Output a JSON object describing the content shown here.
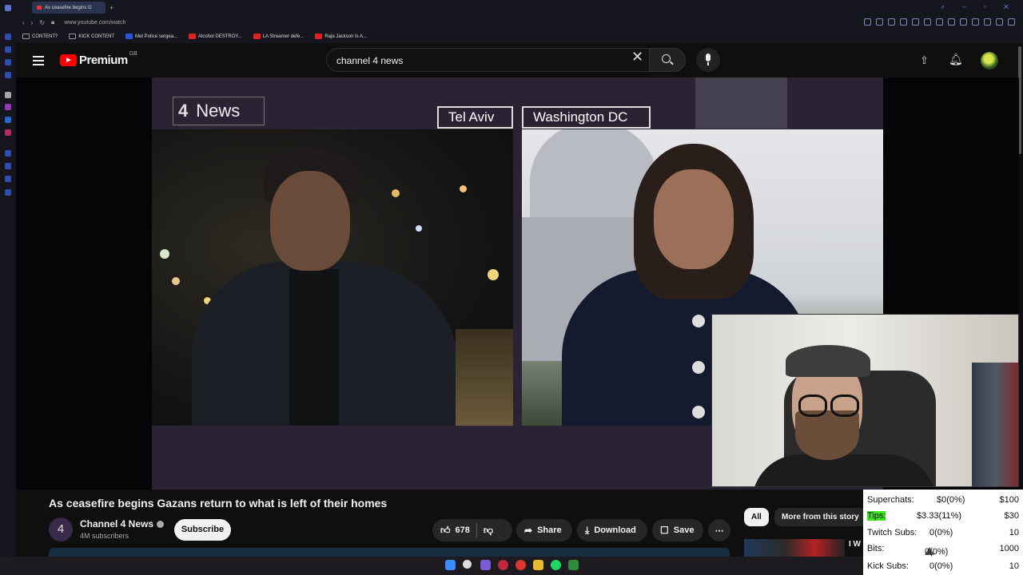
{
  "browser": {
    "tab_title": "As ceasefire begins G",
    "url": "www.youtube.com/watch",
    "bookmarks": [
      "CONTENT?",
      "KICK CONTENT",
      "Met Police sergea...",
      "Alcohol DESTROY...",
      "LA Streamer defe...",
      "Raja Jackson Is A..."
    ]
  },
  "header": {
    "logo_text": "Premium",
    "region": "GB",
    "search_query": "channel 4 news"
  },
  "video": {
    "overlay": {
      "brand": "News",
      "location_left": "Tel Aviv",
      "location_right": "Washington DC"
    },
    "title": "As ceasefire begins Gazans return to what is left of their homes",
    "channel": {
      "avatar_glyph": "4",
      "name": "Channel 4 News",
      "subscribers": "4M subscribers",
      "subscribe_label": "Subscribe"
    },
    "actions": {
      "likes": "678",
      "share": "Share",
      "download": "Download",
      "save": "Save"
    }
  },
  "sidebar": {
    "chips": [
      "All",
      "More from this story"
    ],
    "next_title": "I W Col"
  },
  "stream_stats": [
    {
      "label": "Superchats:",
      "value": "$0(0%)",
      "goal": "$100"
    },
    {
      "label": "Tips:",
      "value": "$3.33(11%)",
      "goal": "$30"
    },
    {
      "label": "Twitch Subs:",
      "value": "0(0%)",
      "goal": "10"
    },
    {
      "label": "Bits:",
      "value": "0(0%)",
      "goal": "1000"
    },
    {
      "label": "Kick Subs:",
      "value": "0(0%)",
      "goal": "10"
    }
  ],
  "colors": {
    "youtube_red": "#ff0000",
    "tips_highlight": "#39e81f"
  }
}
